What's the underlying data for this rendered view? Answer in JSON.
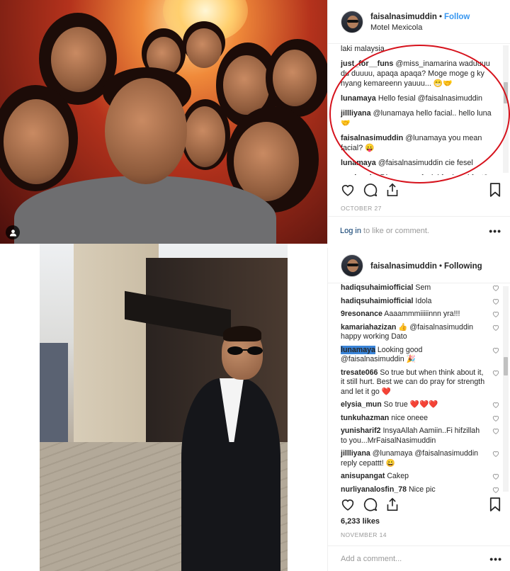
{
  "post1": {
    "username": "faisalnasimuddin",
    "dot": "•",
    "follow_label": "Follow",
    "location": "Motel Mexicola",
    "comments": [
      {
        "user": "",
        "text": "laki malaysia"
      },
      {
        "user": "just_for__funs",
        "text": "@miss_inamarina waduuuu du duuuu, apaqa apaqa? Moge moge g ky nyang kemareenn yauuu... 😁🤝"
      },
      {
        "user": "lunamaya",
        "text": "Hello fesial @faisalnasimuddin"
      },
      {
        "user": "jillliyana",
        "text": "@lunamaya hello facial.. hello luna 🤝"
      },
      {
        "user": "faisalnasimuddin",
        "text": "@lunamaya you mean facial? 😛"
      },
      {
        "user": "lunamaya",
        "text": "@faisalnasimuddin cie fesel"
      },
      {
        "user": "paula_ola",
        "text": "@lunamaya facial for breakfast? Sunny side up or telor orak arik (scramble)?"
      }
    ],
    "date": "OCTOBER 27",
    "login_link": "Log in",
    "login_text": " to like or comment.",
    "more": "•••"
  },
  "post2": {
    "username": "faisalnasimuddin",
    "dot": "•",
    "following_label": "Following",
    "comments": [
      {
        "user": "hadiqsuhaimiofficial",
        "text": "Sem"
      },
      {
        "user": "hadiqsuhaimiofficial",
        "text": "Idola"
      },
      {
        "user": "9resonance",
        "text": "Aaaammmiiiiinnn yra!!!"
      },
      {
        "user": "kamariahazizan",
        "text": "👍 @faisalnasimuddin happy working Dato"
      },
      {
        "user": "lunamaya",
        "text": "Looking good @faisalnasimuddin 🎉"
      },
      {
        "user": "tresate066",
        "text": "So true but when think about it, it still hurt. Best we can do pray for strength and let it go ❤️"
      },
      {
        "user": "elysia_mun",
        "text": "So true ❤️❤️❤️"
      },
      {
        "user": "tunkuhazman",
        "text": "nice oneee"
      },
      {
        "user": "yunisharif2",
        "text": "InsyaAllah Aamiin..Fi hifzillah to you...MrFaisalNasimuddin"
      },
      {
        "user": "jillliyana",
        "text": "@lunamaya @faisalnasimuddin reply cepattt! 😀"
      },
      {
        "user": "anisupangat",
        "text": "Cakep"
      },
      {
        "user": "nurliyanalosfin_78",
        "text": "Nice pic"
      }
    ],
    "likes": "6,233 likes",
    "date": "NOVEMBER 14",
    "add_comment_placeholder": "Add a comment...",
    "more": "•••"
  },
  "colors": {
    "link_blue": "#3897f0",
    "mention_blue": "#003569",
    "highlight": "#3a84d8",
    "annotation_red": "#d6121c"
  },
  "icons": [
    "heart-icon",
    "comment-icon",
    "share-icon",
    "bookmark-icon",
    "user-tag-icon",
    "more-icon"
  ]
}
